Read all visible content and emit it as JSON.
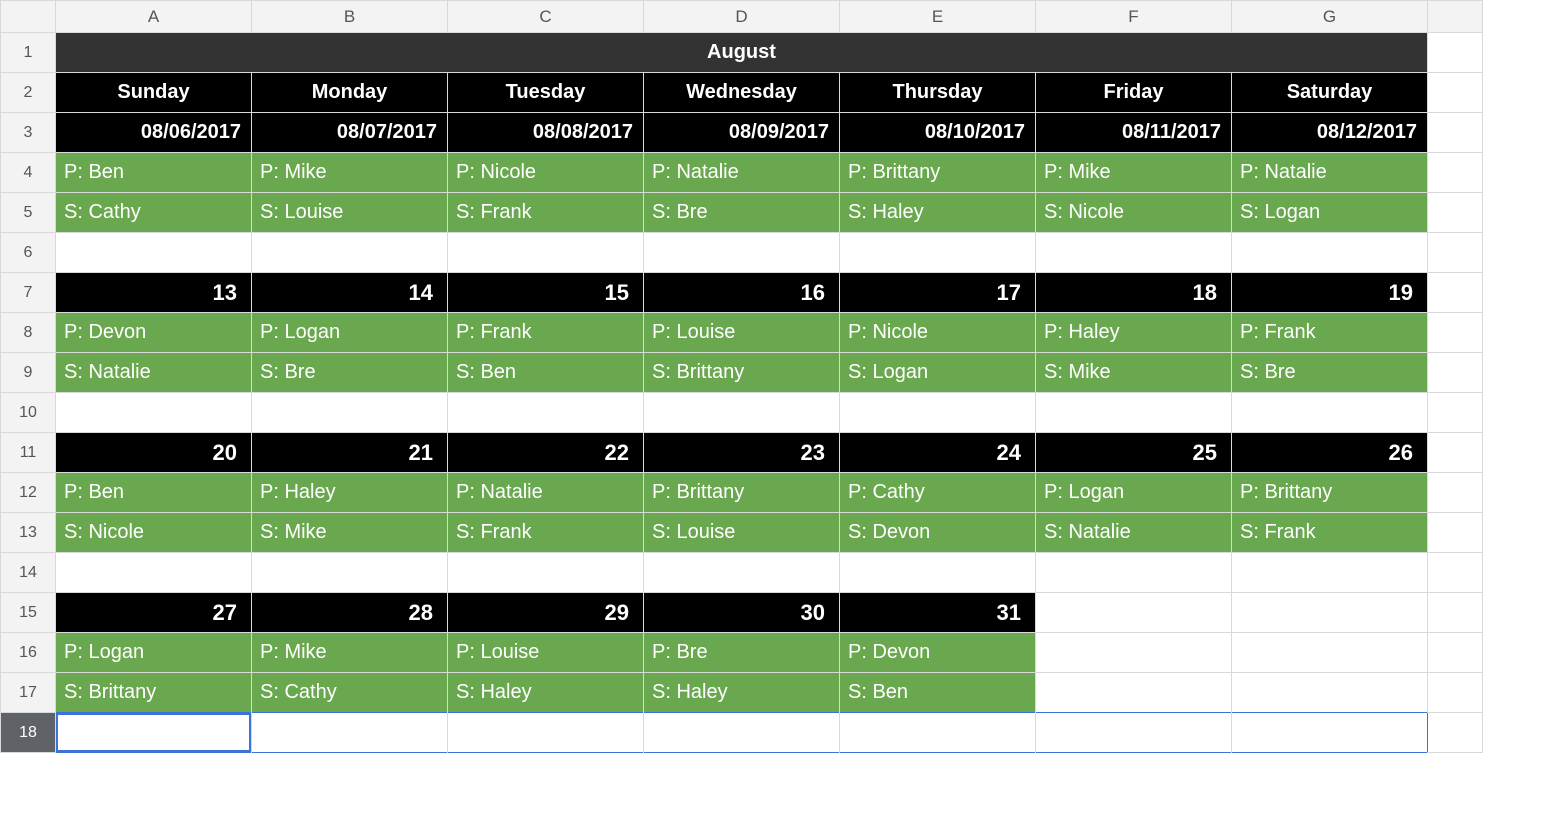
{
  "columns": [
    "A",
    "B",
    "C",
    "D",
    "E",
    "F",
    "G"
  ],
  "title": "August",
  "rows": [
    {
      "num": 1,
      "type": "title"
    },
    {
      "num": 2,
      "type": "dow",
      "cells": [
        "Sunday",
        "Monday",
        "Tuesday",
        "Wednesday",
        "Thursday",
        "Friday",
        "Saturday"
      ]
    },
    {
      "num": 3,
      "type": "date",
      "cells": [
        "08/06/2017",
        "08/07/2017",
        "08/08/2017",
        "08/09/2017",
        "08/10/2017",
        "08/11/2017",
        "08/12/2017"
      ]
    },
    {
      "num": 4,
      "type": "green",
      "cells": [
        "P: Ben",
        "P: Mike",
        "P: Nicole",
        "P: Natalie",
        "P: Brittany",
        "P: Mike",
        "P: Natalie"
      ]
    },
    {
      "num": 5,
      "type": "green",
      "cells": [
        "S: Cathy",
        "S: Louise",
        "S: Frank",
        "S: Bre",
        "S: Haley",
        "S: Nicole",
        "S: Logan"
      ]
    },
    {
      "num": 6,
      "type": "blank",
      "cells": [
        "",
        "",
        "",
        "",
        "",
        "",
        ""
      ]
    },
    {
      "num": 7,
      "type": "daynum",
      "cells": [
        "13",
        "14",
        "15",
        "16",
        "17",
        "18",
        "19"
      ]
    },
    {
      "num": 8,
      "type": "green",
      "cells": [
        "P: Devon",
        "P: Logan",
        "P: Frank",
        "P: Louise",
        "P: Nicole",
        "P: Haley",
        "P: Frank"
      ]
    },
    {
      "num": 9,
      "type": "green",
      "cells": [
        "S: Natalie",
        "S: Bre",
        "S: Ben",
        "S: Brittany",
        "S: Logan",
        "S: Mike",
        "S: Bre"
      ]
    },
    {
      "num": 10,
      "type": "blank",
      "cells": [
        "",
        "",
        "",
        "",
        "",
        "",
        ""
      ]
    },
    {
      "num": 11,
      "type": "daynum",
      "cells": [
        "20",
        "21",
        "22",
        "23",
        "24",
        "25",
        "26"
      ]
    },
    {
      "num": 12,
      "type": "green",
      "cells": [
        "P: Ben",
        "P: Haley",
        "P: Natalie",
        "P: Brittany",
        "P: Cathy",
        "P: Logan",
        "P: Brittany"
      ]
    },
    {
      "num": 13,
      "type": "green",
      "cells": [
        "S: Nicole",
        "S: Mike",
        "S: Frank",
        "S: Louise",
        "S: Devon",
        "S: Natalie",
        "S: Frank"
      ]
    },
    {
      "num": 14,
      "type": "blank",
      "cells": [
        "",
        "",
        "",
        "",
        "",
        "",
        ""
      ]
    },
    {
      "num": 15,
      "type": "daynum-partial",
      "cells": [
        "27",
        "28",
        "29",
        "30",
        "31",
        "",
        ""
      ]
    },
    {
      "num": 16,
      "type": "green-partial",
      "cells": [
        "P: Logan",
        "P: Mike",
        "P: Louise",
        "P: Bre",
        "P: Devon",
        "",
        ""
      ]
    },
    {
      "num": 17,
      "type": "green-partial",
      "cells": [
        "S: Brittany",
        "S: Cathy",
        "S: Haley",
        "S: Haley",
        "S: Ben",
        "",
        ""
      ]
    },
    {
      "num": 18,
      "type": "selected",
      "cells": [
        "",
        "",
        "",
        "",
        "",
        "",
        ""
      ]
    }
  ]
}
